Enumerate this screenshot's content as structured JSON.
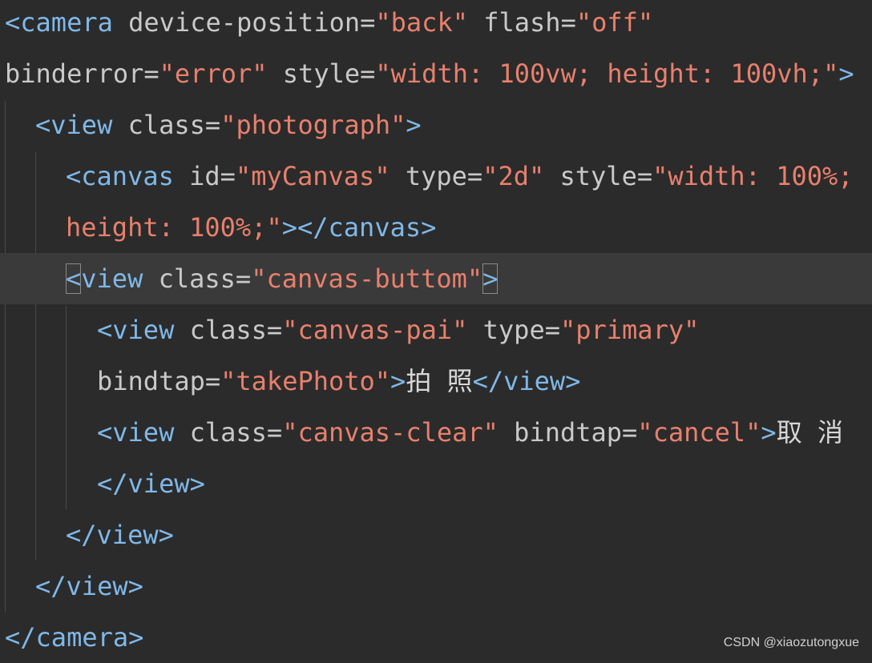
{
  "editor": {
    "lines": [
      {
        "segments": [
          {
            "c": "tk",
            "t": "<camera"
          },
          {
            "c": "at",
            "t": " device-position="
          },
          {
            "c": "st",
            "t": "\"back\""
          },
          {
            "c": "at",
            "t": " flash="
          },
          {
            "c": "st",
            "t": "\"off\""
          }
        ]
      },
      {
        "segments": [
          {
            "c": "at",
            "t": "binderror="
          },
          {
            "c": "st",
            "t": "\"error\""
          },
          {
            "c": "at",
            "t": " style="
          },
          {
            "c": "st",
            "t": "\"width: 100vw; height: 100vh;\""
          },
          {
            "c": "tk",
            "t": ">"
          }
        ]
      },
      {
        "segments": [
          {
            "c": "tk",
            "t": "<view"
          },
          {
            "c": "at",
            "t": " class="
          },
          {
            "c": "st",
            "t": "\"photograph\""
          },
          {
            "c": "tk",
            "t": ">"
          }
        ]
      },
      {
        "segments": [
          {
            "c": "tk",
            "t": "<canvas"
          },
          {
            "c": "at",
            "t": " id="
          },
          {
            "c": "st",
            "t": "\"myCanvas\""
          },
          {
            "c": "at",
            "t": " type="
          },
          {
            "c": "st",
            "t": "\"2d\""
          },
          {
            "c": "at",
            "t": " style="
          },
          {
            "c": "st",
            "t": "\"width: 100%;"
          }
        ]
      },
      {
        "segments": [
          {
            "c": "st",
            "t": "height: 100%;\""
          },
          {
            "c": "tk",
            "t": "></canvas>"
          }
        ]
      },
      {
        "segments": [
          {
            "c": "tk box",
            "t": "<"
          },
          {
            "c": "tk",
            "t": "view"
          },
          {
            "c": "at",
            "t": " class="
          },
          {
            "c": "st",
            "t": "\"canvas-buttom\""
          },
          {
            "c": "tk box",
            "t": ">"
          }
        ]
      },
      {
        "segments": [
          {
            "c": "tk",
            "t": "<view"
          },
          {
            "c": "at",
            "t": " class="
          },
          {
            "c": "st",
            "t": "\"canvas-pai\""
          },
          {
            "c": "at",
            "t": " type="
          },
          {
            "c": "st",
            "t": "\"primary\""
          }
        ]
      },
      {
        "segments": [
          {
            "c": "at",
            "t": "bindtap="
          },
          {
            "c": "st",
            "t": "\"takePhoto\""
          },
          {
            "c": "tk",
            "t": ">"
          },
          {
            "c": "tx",
            "t": "拍 照"
          },
          {
            "c": "tk",
            "t": "</view>"
          }
        ]
      },
      {
        "segments": [
          {
            "c": "tk",
            "t": "<view"
          },
          {
            "c": "at",
            "t": " class="
          },
          {
            "c": "st",
            "t": "\"canvas-clear\""
          },
          {
            "c": "at",
            "t": " bindtap="
          },
          {
            "c": "st",
            "t": "\"cancel\""
          },
          {
            "c": "tk",
            "t": ">"
          },
          {
            "c": "tx",
            "t": "取 消"
          }
        ]
      },
      {
        "segments": [
          {
            "c": "tk",
            "t": "</view>"
          }
        ]
      },
      {
        "segments": [
          {
            "c": "tk",
            "t": "</view>"
          }
        ]
      },
      {
        "segments": [
          {
            "c": "tk",
            "t": "</view>"
          }
        ]
      },
      {
        "segments": [
          {
            "c": "tk",
            "t": "</camera>"
          }
        ]
      }
    ]
  },
  "watermark": "CSDN @xiaozutongxue",
  "colors": {
    "background": "#2b2b2b",
    "current_line": "#3a3a3a",
    "tag": "#7fb8e8",
    "attribute": "#c9c9c9",
    "string": "#e8806d",
    "text": "#d8d8d8"
  }
}
